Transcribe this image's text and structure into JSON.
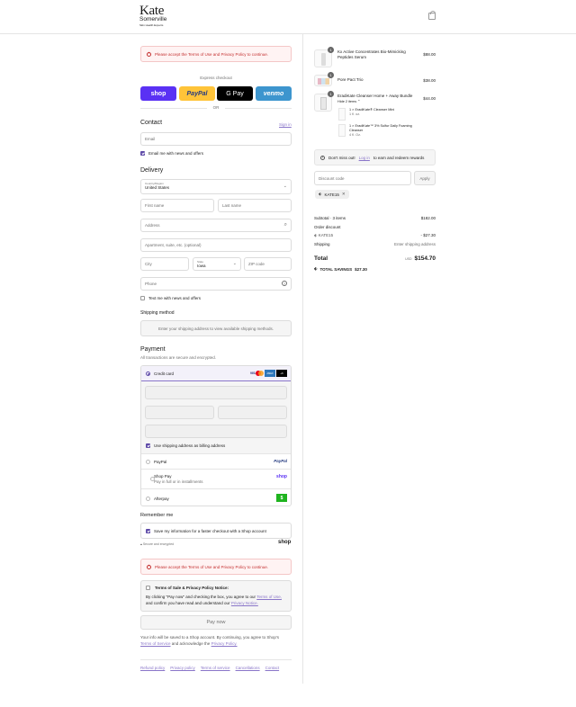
{
  "header": {
    "brand_top": "Kate",
    "brand_bottom": "Somerville",
    "tagline": "Skin Health Experts",
    "cart_icon": "bag-icon"
  },
  "alert": {
    "text": "Please accept the Terms of Use and Privacy Policy to continue."
  },
  "express": {
    "title": "Express checkout",
    "buttons": [
      {
        "label": "shop",
        "bg": "#5a31f4",
        "fg": "#ffffff"
      },
      {
        "label": "PayPal",
        "bg": "#ffc439",
        "fg": "#253b80"
      },
      {
        "label": "G Pay",
        "bg": "#000000",
        "fg": "#ffffff"
      },
      {
        "label": "venmo",
        "bg": "#3d95ce",
        "fg": "#ffffff"
      }
    ],
    "or": "OR"
  },
  "contact": {
    "title": "Contact",
    "sign_in": "Sign in",
    "email_placeholder": "Email",
    "news_label": "Email me with news and offers"
  },
  "delivery": {
    "title": "Delivery",
    "country_label": "Country/Region",
    "country_value": "United States",
    "first_name": "First name",
    "last_name": "Last name",
    "address": "Address",
    "apartment": "Apartment, suite, etc. (optional)",
    "city": "City",
    "state_label": "State",
    "state_value": "Iowa",
    "zip": "ZIP code",
    "phone": "Phone",
    "text_offers": "Text me with news and offers"
  },
  "shipping_method": {
    "title": "Shipping method",
    "message": "Enter your shipping address to view available shipping methods."
  },
  "payment": {
    "title": "Payment",
    "subtitle": "All transactions are secure and encrypted.",
    "credit_card": "Credit card",
    "card_logos": [
      "VISA",
      "MC",
      "AMEX",
      "+6"
    ],
    "billing_same": "Use shipping address as billing address",
    "paypal": "PayPal",
    "paypal_logo": "PayPal",
    "shop_pay": "Shop Pay",
    "shop_pay_sub": "Pay in full or in installments",
    "shop_logo": "shop",
    "afterpay": "Afterpay",
    "afterpay_logo": "$"
  },
  "remember": {
    "title": "Remember me",
    "save_label": "Save my information for a faster checkout with a Shop account",
    "secure": "Secure and encrypted",
    "shop": "shop"
  },
  "terms": {
    "title": "Terms of Sale & Privacy Policy Notice:",
    "line1": "By clicking \"Pay now\" and checking the box, you agree to our",
    "terms_link": "Terms of Use,",
    "line2": "and confirm you have read and understand our",
    "privacy_link": "Privacy Notice."
  },
  "pay_now": "Pay now",
  "shop_notice": {
    "line1": "Your info will be saved to a Shop account. By continuing, you agree to Shop's",
    "terms_link": "Terms of Service",
    "mid": "and acknowledge the",
    "privacy_link": "Privacy Policy."
  },
  "footer_links": [
    "Refund policy",
    "Privacy policy",
    "Terms of service",
    "Cancellations",
    "Contact"
  ],
  "cart": {
    "items": [
      {
        "qty": "1",
        "name": "Kx Active Concentrates Bio-Mimicking Peptides Serum",
        "price": "$88.00"
      },
      {
        "qty": "1",
        "name": "Pore Pact Trio",
        "price": "$38.00"
      },
      {
        "qty": "1",
        "name": "EradiKate Cleanser Home + Away Bundle",
        "price": "$44.00",
        "toggle": "Hide 2 items",
        "sub": [
          {
            "name": "1 × EradiKate® Cleanser Mini",
            "size": "1 fl. oz."
          },
          {
            "name": "1 × EradiKate™ 3% Sulfur Daily Foaming Cleanser",
            "size": "4 fl. Oz."
          }
        ]
      }
    ],
    "notice": "Don't miss out!",
    "notice_link": "Log in",
    "notice_tail": "to earn and redeem rewards",
    "discount_placeholder": "Discount code",
    "apply": "Apply",
    "code_tag": "KATE15",
    "subtotal_label": "Subtotal · 3 items",
    "subtotal": "$182.00",
    "order_discount": "Order discount",
    "discount_code": "KATE15",
    "discount_value": "- $27.30",
    "shipping_label": "Shipping",
    "shipping_value": "Enter shipping address",
    "total_label": "Total",
    "currency": "USD",
    "total": "$154.70",
    "savings_label": "TOTAL SAVINGS",
    "savings": "$27.30"
  }
}
